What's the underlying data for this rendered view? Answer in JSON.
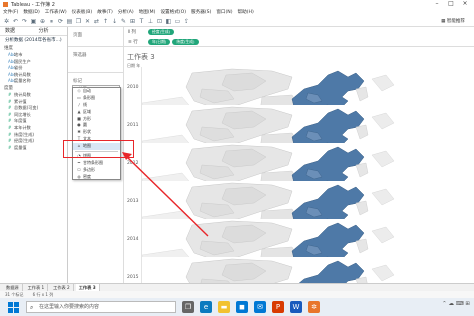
{
  "window": {
    "title": "Tableau - 工作簿 2"
  },
  "menu": [
    "文件(F)",
    "数据(D)",
    "工作表(W)",
    "仪表板(B)",
    "故事(T)",
    "分析(A)",
    "地图(M)",
    "设置格式(O)",
    "服务器(S)",
    "窗口(N)",
    "帮助(H)"
  ],
  "data_pane": {
    "tabs": [
      "数据",
      "分析"
    ],
    "source": "分析数据 (2014年各省市...)",
    "dimensions_label": "维度",
    "dimensions": [
      "地市",
      "国民生产",
      "省份",
      "统计局数",
      "度量名称"
    ],
    "measures_label": "度量",
    "measures": [
      "统计局数",
      "累计值",
      "总数据(可变)",
      "同比增长",
      "年度值",
      "本年计数",
      "纬度(生成)",
      "经度(生成)",
      "度量值"
    ]
  },
  "cards": {
    "pages": "页面",
    "filters": "筛选器",
    "marks": "标记",
    "marks_selected": "地图"
  },
  "mark_types": [
    "自动",
    "条形图",
    "线",
    "区域",
    "方形",
    "圆",
    "形状",
    "文本",
    "地图",
    "饼图",
    "甘特条形图",
    "多边形",
    "密度"
  ],
  "mark_selected_index": 8,
  "shelves": {
    "columns_label": "列",
    "columns_pills": [
      "经度(生成)"
    ],
    "rows_label": "行",
    "rows_pills": [
      "年(日期)",
      "纬度(生成)"
    ]
  },
  "view": {
    "sheet_title": "工作表 3",
    "row_header": "日期 年",
    "rows": [
      "2010",
      "2011",
      "2012",
      "2013",
      "2014",
      "2015"
    ]
  },
  "sheet_tabs": [
    "数据源",
    "工作表 1",
    "工作表 2",
    "工作表 3"
  ],
  "active_sheet_index": 3,
  "status": [
    "31 个标记",
    "6 行 x 1 列"
  ],
  "taskbar": {
    "search_placeholder": "在这里输入你要搜索的内容"
  },
  "colors": {
    "map_fill": "#4e79a7",
    "pill_green": "#21a67a",
    "highlight_red": "#e8262a"
  }
}
